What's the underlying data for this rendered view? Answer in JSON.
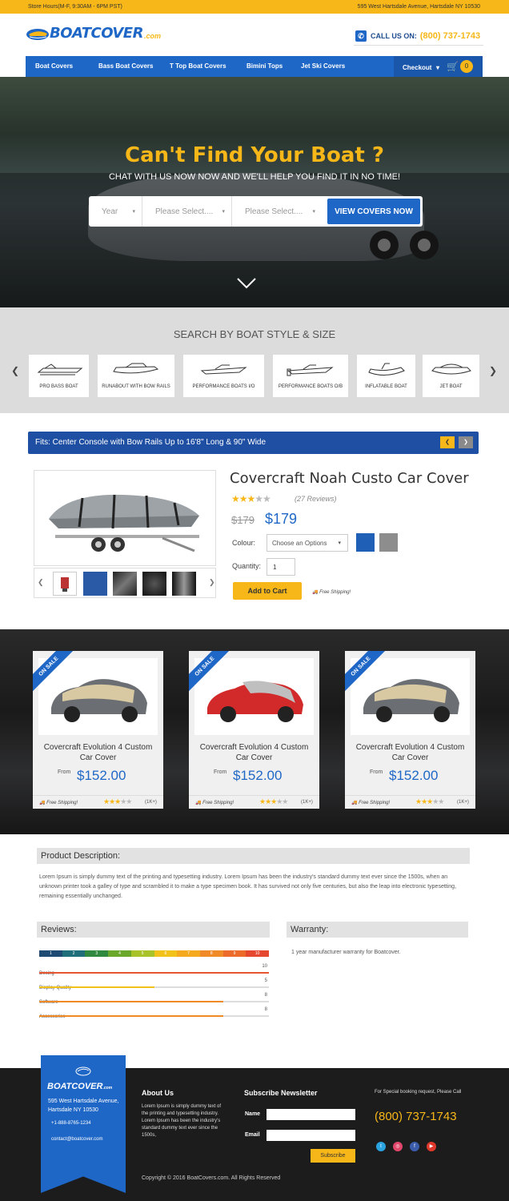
{
  "topbar": {
    "hours": "Store Hours(M-F, 9:30AM - 6PM PST)",
    "address": "595 West Hartsdale Avenue, Hartsdale NY 10530"
  },
  "header": {
    "logo_text": "BOATCOVER",
    "logo_suffix": ".com",
    "call_label": "CALL US ON:",
    "phone": "(800) 737-1743"
  },
  "nav": {
    "items": [
      "Boat Covers",
      "Bass Boat Covers",
      "T Top Boat Covers",
      "Bimini Tops",
      "Jet Ski Covers"
    ],
    "checkout": "Checkout",
    "cart_count": "0"
  },
  "hero": {
    "title": "Can't Find Your Boat ?",
    "subtitle": "CHAT WITH US NOW NOW AND WE'LL HELP YOU FIND IT IN NO TIME!",
    "year": "Year",
    "select1": "Please Select....",
    "select2": "Please Select....",
    "button": "VIEW COVERS NOW"
  },
  "styles": {
    "title": "SEARCH BY BOAT STYLE & SIZE",
    "items": [
      "PRO BASS BOAT",
      "RUNABOUT WITH BOW RAILS",
      "PERFORMANCE BOATS I/O",
      "PERFORMANCE BOATS O/B",
      "INFLATABLE BOAT",
      "JET BOAT"
    ]
  },
  "product": {
    "fits": "Fits: Center Console with Bow Rails Up to 16'8\" Long & 90\" Wide",
    "title": "Covercraft Noah Custo Car Cover",
    "reviews": "(27 Reviews)",
    "rating": 3,
    "old_price": "$179",
    "price": "$179",
    "colour_label": "Colour:",
    "colour_select": "Choose an Options",
    "swatches": [
      "#1f5fb5",
      "#8d8d8d"
    ],
    "quantity_label": "Quantity:",
    "quantity": "1",
    "add_to_cart": "Add to Cart",
    "free_shipping": "Free Shipping!"
  },
  "deals": {
    "ribbon": "ON SALE",
    "items": [
      {
        "name": "Covercraft Evolution 4 Custom Car Cover",
        "from": "From",
        "price": "$152.00",
        "shipping": "Free Shipping!",
        "count": "(1K+)",
        "rating": 3
      },
      {
        "name": "Covercraft Evolution 4 Custom Car Cover",
        "from": "From",
        "price": "$152.00",
        "shipping": "Free Shipping!",
        "count": "(1K+)",
        "rating": 3
      },
      {
        "name": "Covercraft Evolution 4 Custom Car Cover",
        "from": "From",
        "price": "$152.00",
        "shipping": "Free Shipping!",
        "count": "(1K+)",
        "rating": 3
      }
    ]
  },
  "description": {
    "title": "Product Description:",
    "text": "Lorem Ipsum is simply dummy text of the printing and typesetting industry. Lorem Ipsum has been the industry's standard dummy text ever since the 1500s, when an unknown printer took a galley of type and scrambled it to make a type specimen book. It has survived not only five centuries, but also the leap into electronic typesetting, remaining essentially unchanged."
  },
  "reviews": {
    "title": "Reviews:",
    "scale": [
      "1",
      "2",
      "3",
      "4",
      "5",
      "6",
      "7",
      "8",
      "9",
      "10"
    ],
    "items": [
      {
        "name": "Desing",
        "value": "10",
        "score": 10,
        "color": "#e6552f"
      },
      {
        "name": "Display Quality",
        "value": "5",
        "score": 5,
        "color": "#f2c21b"
      },
      {
        "name": "Software",
        "value": "8",
        "score": 8,
        "color": "#f08a26"
      },
      {
        "name": "Accessories",
        "value": "8",
        "score": 8,
        "color": "#f08a26"
      }
    ]
  },
  "warranty": {
    "title": "Warranty:",
    "text": "1 year manufacturer warranty for Boatcover."
  },
  "footer": {
    "logo": "BOATCOVER",
    "logo_suffix": ".com",
    "address": "595 West Hartsdale Avenue, Hartsdale NY 10530",
    "phone": "+1-888-8765-1234",
    "email": "contact@boatcover.com",
    "about_title": "About Us",
    "about_text": "Lorem Ipsum is simply dummy text of the printing and typesetting industry. Lorem Ipsum has been the industry's standard dummy text ever since the 1500s,",
    "newsletter_title": "Subscribe Newsletter",
    "name_label": "Name",
    "email_label": "Email",
    "subscribe": "Subscribe",
    "special": "For Special booking request, Please Call",
    "big_phone": "(800) 737-1743",
    "copyright": "Copyright © 2016  BoatCovers.com. All Rights Reserved"
  },
  "colors": {
    "accent": "#f7b718",
    "brand": "#1f67c6"
  }
}
